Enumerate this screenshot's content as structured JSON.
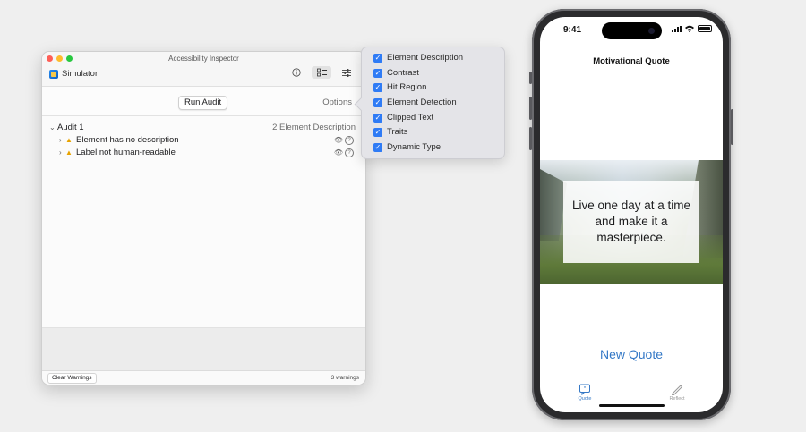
{
  "inspector": {
    "window_title": "Accessibility Inspector",
    "target": "Simulator",
    "toolbar_icons": [
      "info-icon",
      "audit-icon",
      "settings-icon"
    ],
    "run_audit_label": "Run Audit",
    "options_label": "Options",
    "audit": {
      "label": "Audit 1",
      "count_label": "2 Element Description",
      "issues": [
        {
          "label": "Element has no description"
        },
        {
          "label": "Label not human-readable"
        }
      ]
    },
    "footer": {
      "clear_label": "Clear Warnings",
      "warnings_label": "3 warnings"
    }
  },
  "options_popover": {
    "items": [
      {
        "label": "Element Description",
        "checked": true
      },
      {
        "label": "Contrast",
        "checked": true
      },
      {
        "label": "Hit Region",
        "checked": true
      },
      {
        "label": "Element Detection",
        "checked": true
      },
      {
        "label": "Clipped Text",
        "checked": true
      },
      {
        "label": "Traits",
        "checked": true
      },
      {
        "label": "Dynamic Type",
        "checked": true
      }
    ],
    "accent_color": "#2f7bf5"
  },
  "phone": {
    "time": "9:41",
    "nav_title": "Motivational Quote",
    "quote": "Live one day at a time and make it a masterpiece.",
    "new_quote_label": "New Quote",
    "accent_color": "#3478c6",
    "tabs": [
      {
        "label": "Quote",
        "icon": "quote-bubble-icon",
        "selected": true
      },
      {
        "label": "Reflect",
        "icon": "pencil-icon",
        "selected": false
      }
    ]
  }
}
